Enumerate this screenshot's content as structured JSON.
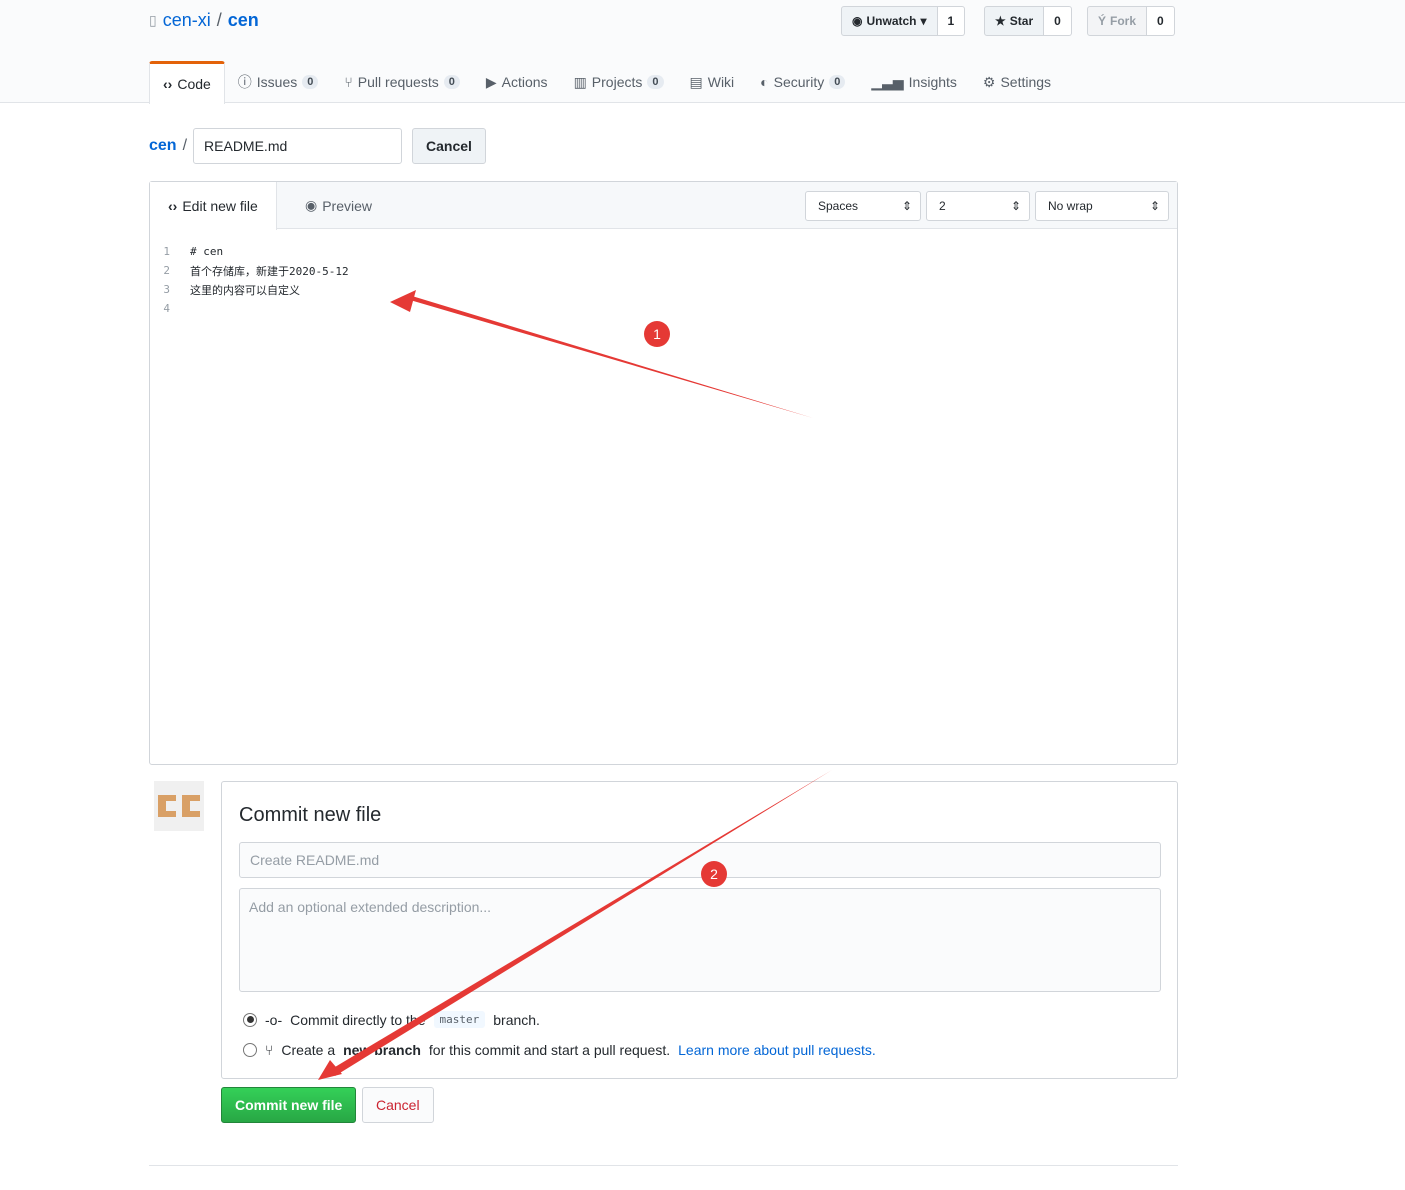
{
  "repo": {
    "owner": "cen-xi",
    "separator": "/",
    "name": "cen"
  },
  "actions": [
    {
      "label": "Unwatch",
      "count": "1"
    },
    {
      "label": "Star",
      "count": "0"
    },
    {
      "label": "Fork",
      "count": "0"
    }
  ],
  "tabs": [
    {
      "label": "Code",
      "icon": "code-icon"
    },
    {
      "label": "Issues",
      "count": "0",
      "icon": "issue-icon"
    },
    {
      "label": "Pull requests",
      "count": "0",
      "icon": "pull-request-icon"
    },
    {
      "label": "Actions",
      "icon": "play-icon"
    },
    {
      "label": "Projects",
      "count": "0",
      "icon": "project-icon"
    },
    {
      "label": "Wiki",
      "icon": "book-icon"
    },
    {
      "label": "Security",
      "count": "0",
      "icon": "shield-icon"
    },
    {
      "label": "Insights",
      "icon": "graph-icon"
    },
    {
      "label": "Settings",
      "icon": "gear-icon"
    }
  ],
  "path": {
    "root": "cen",
    "separator": "/",
    "filename": "README.md",
    "cancel": "Cancel"
  },
  "editor": {
    "edit_tab": "Edit new file",
    "preview_tab": "Preview",
    "indent_mode": "Spaces",
    "indent_size": "2",
    "wrap_mode": "No wrap",
    "lines": [
      {
        "n": "1",
        "text": "# cen"
      },
      {
        "n": "2",
        "text": "首个存储库，新建于2020-5-12"
      },
      {
        "n": "3",
        "text": "这里的内容可以自定义"
      },
      {
        "n": "4",
        "text": ""
      }
    ]
  },
  "commit": {
    "title": "Commit new file",
    "summary_placeholder": "Create README.md",
    "description_placeholder": "Add an optional extended description...",
    "option1_pre": "Commit directly to the",
    "branch": "master",
    "option1_post": "branch.",
    "option2_pre": "Create a",
    "option2_bold": "new branch",
    "option2_post": "for this commit and start a pull request.",
    "option2_link": "Learn more about pull requests.",
    "submit": "Commit new file",
    "cancel": "Cancel"
  },
  "annotations": {
    "mark1": "1",
    "mark2": "2",
    "color": "#e53935"
  }
}
